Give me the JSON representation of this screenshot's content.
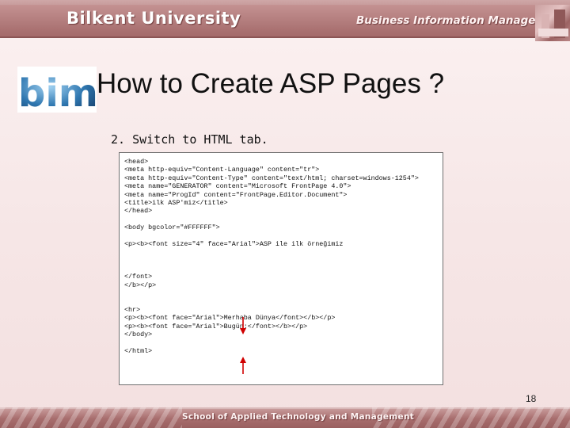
{
  "header": {
    "university": "Bilkent University",
    "department": "Business Information Management"
  },
  "logo": {
    "text": "bim"
  },
  "slide": {
    "title": "How to Create ASP Pages ?",
    "step": "2. Switch to HTML tab.",
    "page_number": "18"
  },
  "code_lines": [
    "<head>",
    "<meta http-equiv=\"Content-Language\" content=\"tr\">",
    "<meta http-equiv=\"Content-Type\" content=\"text/html; charset=windows-1254\">",
    "<meta name=\"GENERATOR\" content=\"Microsoft FrontPage 4.0\">",
    "<meta name=\"ProgId\" content=\"FrontPage.Editor.Document\">",
    "<title>ilk ASP'miz</title>",
    "</head>",
    "",
    "<body bgcolor=\"#FFFFFF\">",
    "",
    "<p><b><font size=\"4\" face=\"Arial\">ASP ile ilk örneğimiz",
    "",
    "",
    "",
    "</font>",
    "</b></p>",
    "",
    "",
    "<hr>",
    "<p><b><font face=\"Arial\">Merhaba Dünya</font></b></p>",
    "<p><b><font face=\"Arial\">Bugün:</font></b></p>",
    "</body>",
    "",
    "</html>"
  ],
  "footer": {
    "school": "School of Applied Technology and Management"
  },
  "colors": {
    "accent": "#a86e6e",
    "arrow": "#d00000",
    "logo_blue": "#1f5a8a"
  }
}
